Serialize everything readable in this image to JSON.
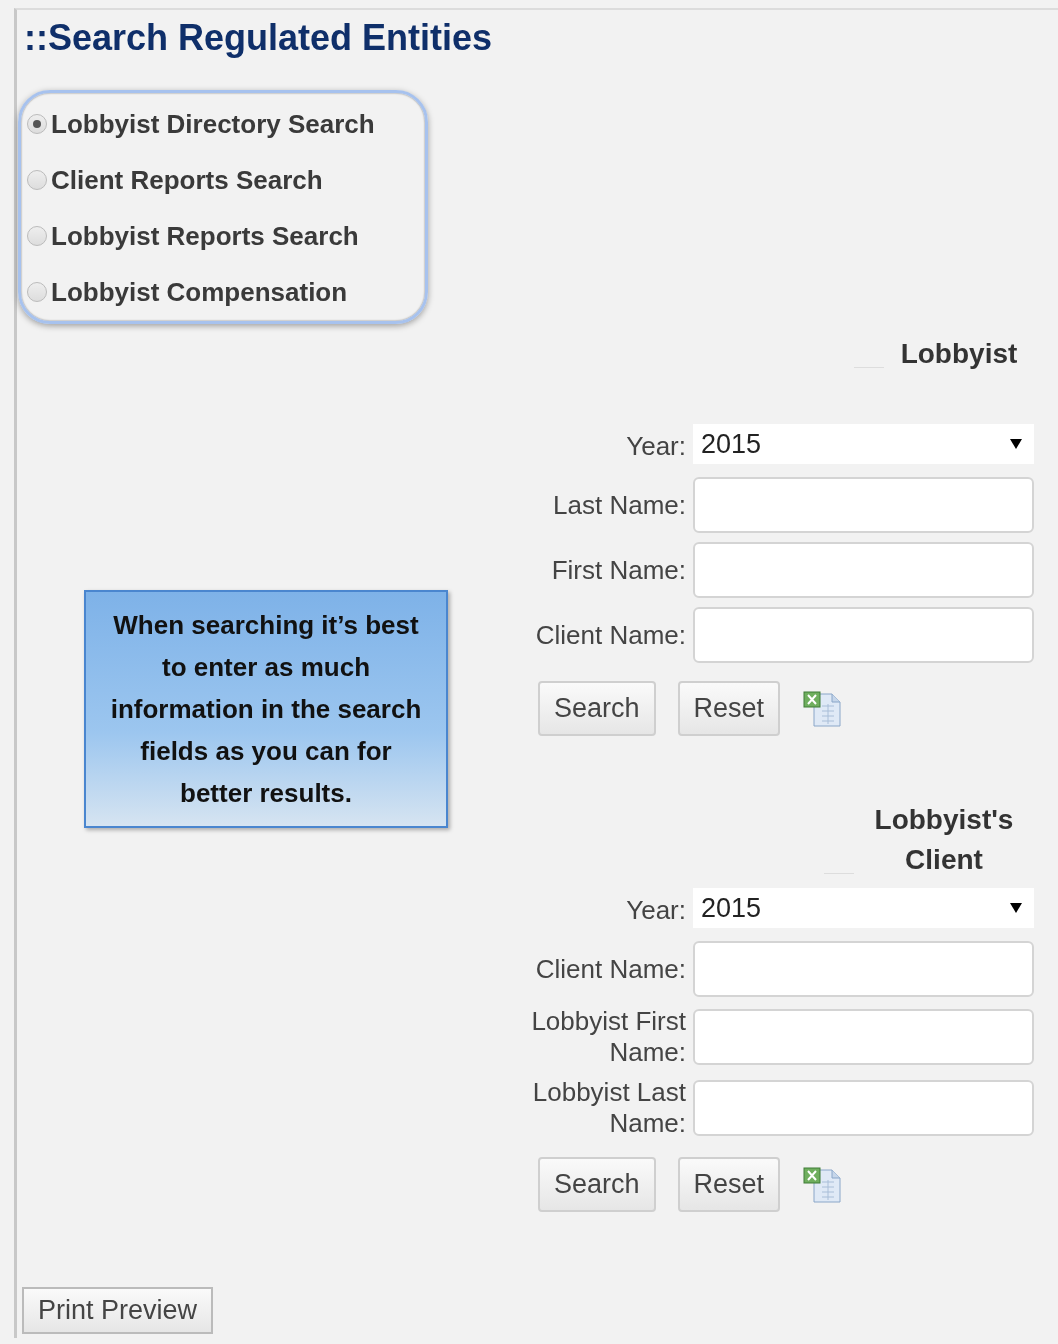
{
  "page_title": "::Search Regulated Entities",
  "search_types": [
    {
      "label": "Lobbyist Directory Search",
      "selected": true
    },
    {
      "label": "Client Reports Search",
      "selected": false
    },
    {
      "label": "Lobbyist Reports Search",
      "selected": false
    },
    {
      "label": "Lobbyist Compensation",
      "selected": false
    }
  ],
  "tip": "When searching it’s best to enter as much information in the search fields as you can for better results.",
  "sections": [
    {
      "heading": "Lobbyist",
      "fields": [
        {
          "kind": "select",
          "label": "Year:",
          "value": "2015"
        },
        {
          "kind": "text",
          "label": "Last Name:"
        },
        {
          "kind": "text",
          "label": "First Name:"
        },
        {
          "kind": "text",
          "label": "Client Name:"
        }
      ],
      "buttons": [
        "Search",
        "Reset"
      ]
    },
    {
      "heading": "Lobbyist's Client",
      "fields": [
        {
          "kind": "select",
          "label": "Year:",
          "value": "2015"
        },
        {
          "kind": "text",
          "label": "Client Name:"
        },
        {
          "kind": "text",
          "label": "Lobbyist First Name:"
        },
        {
          "kind": "text",
          "label": "Lobbyist Last Name:"
        }
      ],
      "buttons": [
        "Search",
        "Reset"
      ]
    }
  ],
  "print_button": "Print Preview"
}
